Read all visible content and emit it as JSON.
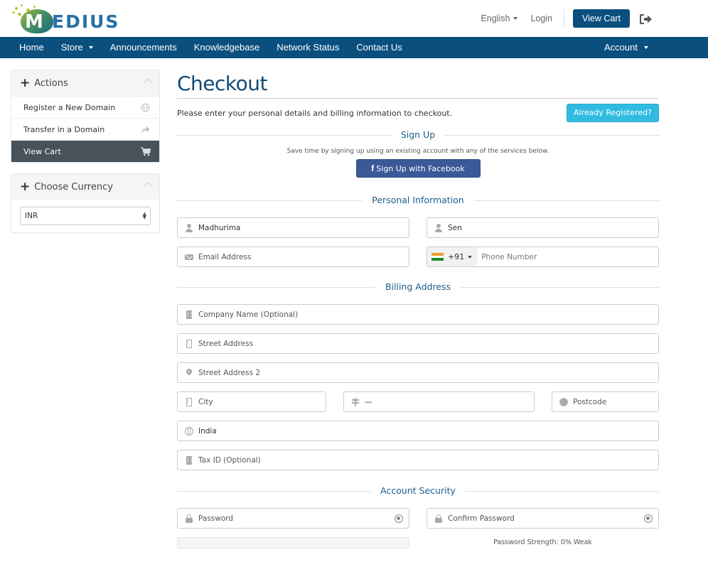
{
  "header": {
    "logo_text": "EDIUS",
    "logo_initial": "M",
    "language": "English",
    "login": "Login",
    "view_cart": "View Cart",
    "logout_icon": "sign-out-icon"
  },
  "nav": {
    "items": [
      {
        "label": "Home",
        "dropdown": false
      },
      {
        "label": "Store",
        "dropdown": true
      },
      {
        "label": "Announcements",
        "dropdown": false
      },
      {
        "label": "Knowledgebase",
        "dropdown": false
      },
      {
        "label": "Network Status",
        "dropdown": false
      },
      {
        "label": "Contact Us",
        "dropdown": false
      }
    ],
    "account": "Account"
  },
  "sidebar": {
    "actions": {
      "title": "Actions",
      "items": [
        {
          "label": "Register a New Domain",
          "icon": "globe-icon",
          "active": false
        },
        {
          "label": "Transfer in a Domain",
          "icon": "share-icon",
          "active": false
        },
        {
          "label": "View Cart",
          "icon": "cart-icon",
          "active": true
        }
      ]
    },
    "currency": {
      "title": "Choose Currency",
      "selected": "INR"
    }
  },
  "main": {
    "title": "Checkout",
    "intro": "Please enter your personal details and billing information to checkout.",
    "already_registered": "Already Registered?",
    "signup": {
      "heading": "Sign Up",
      "subtext": "Save time by signing up using an existing account with any of the services below.",
      "facebook_icon": "f",
      "facebook_label": "Sign Up with Facebook"
    },
    "personal": {
      "heading": "Personal Information",
      "first_name": "Madhurima",
      "last_name": "Sen",
      "email_placeholder": "Email Address",
      "phone_code": "+91",
      "phone_placeholder": "Phone Number"
    },
    "billing": {
      "heading": "Billing Address",
      "company_placeholder": "Company Name (Optional)",
      "street_placeholder": "Street Address",
      "street2_placeholder": "Street Address 2",
      "city_placeholder": "City",
      "state_value": "—",
      "postcode_placeholder": "Postcode",
      "country": "India",
      "taxid_placeholder": "Tax ID (Optional)"
    },
    "security": {
      "heading": "Account Security",
      "password_placeholder": "Password",
      "confirm_placeholder": "Confirm Password",
      "strength_label": "Password Strength: 0% Weak",
      "strength_percent": 0
    }
  },
  "colors": {
    "brand": "#0a4f7e",
    "accent_info": "#31bbe0",
    "facebook": "#3b5998",
    "active_sidebar": "#47525b"
  }
}
